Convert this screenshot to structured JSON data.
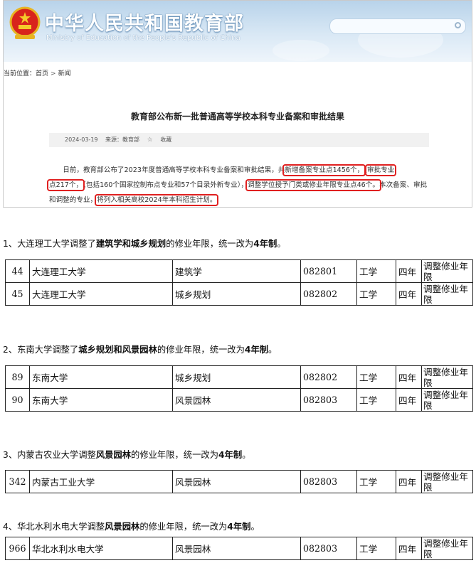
{
  "header": {
    "site_title": "中华人民共和国教育部",
    "site_subtitle": "Ministry of Education of the People's Republic of China"
  },
  "breadcrumb": {
    "prefix": "当前位置：",
    "home": "首页",
    "current": "新闻"
  },
  "article": {
    "title": "教育部公布新一批普通高等学校本科专业备案和审批结果",
    "date": "2024-03-19",
    "source": "来源：教育部",
    "favorite_label": "收藏",
    "paragraph": {
      "p1": "日前，教育部公布了2023年度普通高等学校本科专业备案和审批结果，共",
      "h1": "新增备案专业点1456个，",
      "h2a": "审批专业",
      "h2b": "点217个，",
      "p2": "包括160个国家控制布点专业和57个目录外新专业）",
      "h3": "调整学位授予门类或修业年限专业点46个。",
      "p3": "本次备案、审批和调整的专业，",
      "h4": "将列入相关高校2024年本科招生计划。"
    }
  },
  "sections": [
    {
      "n": "1、",
      "t1": "大连理工大学调整了",
      "b1": "建筑学和城乡规划",
      "t2": "的修业年限，统一改为",
      "b2": "4年制",
      "end": "。",
      "rows": [
        {
          "no": "44",
          "school": "大连理工大学",
          "major": "建筑学",
          "code": "082801",
          "cat": "工学",
          "years": "四年",
          "note": "调整修业年限"
        },
        {
          "no": "45",
          "school": "大连理工大学",
          "major": "城乡规划",
          "code": "082802",
          "cat": "工学",
          "years": "四年",
          "note": "调整修业年限"
        }
      ]
    },
    {
      "n": "2、",
      "t1": "东南大学调整了",
      "b1": "城乡规划和风景园林",
      "t2": "的修业年限，统一改为",
      "b2": "4年制",
      "end": "。",
      "rows": [
        {
          "no": "89",
          "school": "东南大学",
          "major": "城乡规划",
          "code": "082802",
          "cat": "工学",
          "years": "四年",
          "note": "调整修业年限"
        },
        {
          "no": "90",
          "school": "东南大学",
          "major": "风景园林",
          "code": "082803",
          "cat": "工学",
          "years": "四年",
          "note": "调整修业年限"
        }
      ]
    },
    {
      "n": "3、",
      "t1": "内蒙古农业大学调整",
      "b1": "风景园林",
      "t2": "的修业年限，统一改为",
      "b2": "4年制",
      "end": "。",
      "rows": [
        {
          "no": "342",
          "school": "内蒙古工业大学",
          "major": "风景园林",
          "code": "082803",
          "cat": "工学",
          "years": "四年",
          "note": "调整修业年限"
        }
      ]
    },
    {
      "n": "4、",
      "t1": "华北水利水电大学调整",
      "b1": "风景园林",
      "t2": "的修业年限，统一改为",
      "b2": "4年制",
      "end": "。",
      "rows": [
        {
          "no": "966",
          "school": "华北水利水电大学",
          "major": "风景园林",
          "code": "082803",
          "cat": "工学",
          "years": "四年",
          "note": "调整修业年限"
        }
      ]
    }
  ]
}
